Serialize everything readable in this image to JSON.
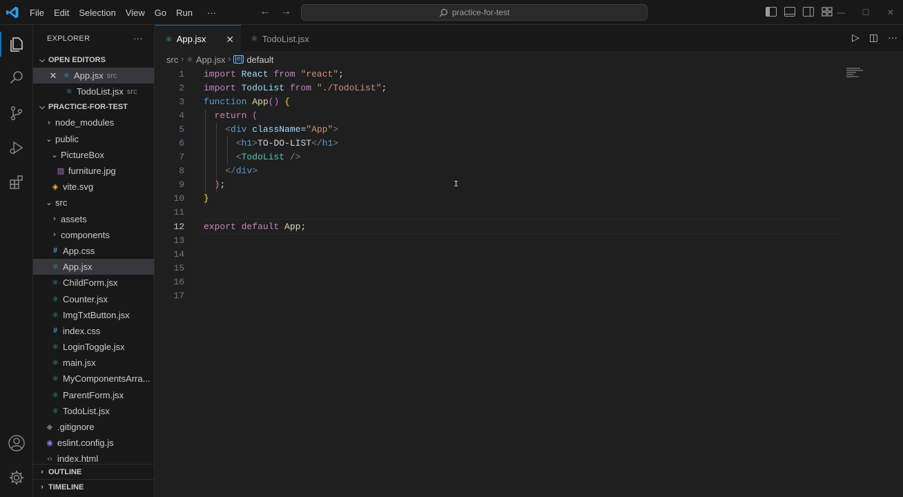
{
  "titlebar": {
    "menu": [
      "File",
      "Edit",
      "Selection",
      "View",
      "Go",
      "Run",
      "···"
    ],
    "command_center": "practice-for-test",
    "back_icon": "arrow-left-icon",
    "forward_icon": "arrow-right-icon"
  },
  "sidebar": {
    "title": "EXPLORER",
    "more": "···",
    "open_editors_label": "OPEN EDITORS",
    "open_editors": [
      {
        "name": "App.jsx",
        "hint": "src"
      },
      {
        "name": "TodoList.jsx",
        "hint": "src"
      }
    ],
    "project_label": "PRACTICE-FOR-TEST",
    "tree": {
      "node_modules": "node_modules",
      "public": "public",
      "picturebox": "PictureBox",
      "furniture": "furniture.jpg",
      "vite": "vite.svg",
      "src": "src",
      "assets": "assets",
      "components": "components",
      "app_css": "App.css",
      "app_jsx": "App.jsx",
      "childform": "ChildForm.jsx",
      "counter": "Counter.jsx",
      "imgtxt": "ImgTxtButton.jsx",
      "index_css": "index.css",
      "logintoggle": "LoginToggle.jsx",
      "main": "main.jsx",
      "mycomponents": "MyComponentsArra...",
      "parentform": "ParentForm.jsx",
      "todolist": "TodoList.jsx",
      "gitignore": ".gitignore",
      "eslint": "eslint.config.js",
      "index_html": "index.html"
    },
    "outline_label": "OUTLINE",
    "timeline_label": "TIMELINE"
  },
  "tabs": [
    {
      "label": "App.jsx",
      "active": true
    },
    {
      "label": "TodoList.jsx",
      "active": false
    }
  ],
  "breadcrumb": {
    "folder": "src",
    "file": "App.jsx",
    "symbol": "default"
  },
  "editor": {
    "line_numbers": [
      "1",
      "2",
      "3",
      "4",
      "5",
      "6",
      "7",
      "8",
      "9",
      "10",
      "11",
      "12",
      "13",
      "14",
      "15",
      "16",
      "17"
    ],
    "current_line": "12",
    "code": {
      "l1_import": "import",
      "l1_name": "React",
      "l1_from": "from",
      "l1_str": "\"react\"",
      "l1_end": ";",
      "l2_import": "import",
      "l2_name": "TodoList",
      "l2_from": "from",
      "l2_str": "\"./TodoList\"",
      "l2_end": ";",
      "l3_kw": "function",
      "l3_fn": "App",
      "l3_paren": "()",
      "l3_brace": "{",
      "l4_kw": "return",
      "l4_paren": "(",
      "l5_open": "<",
      "l5_tag": "div",
      "l5_attr": "className",
      "l5_eq": "=",
      "l5_val": "\"App\"",
      "l5_close": ">",
      "l6_open": "<",
      "l6_tag": "h1",
      "l6_close": ">",
      "l6_text": "TO-DO-LIST",
      "l6_end_open": "</",
      "l6_end_tag": "h1",
      "l6_end_close": ">",
      "l7_open": "<",
      "l7_tag": "TodoList",
      "l7_close": " />",
      "l8_open": "</",
      "l8_tag": "div",
      "l8_close": ">",
      "l9_paren": ")",
      "l9_semi": ";",
      "l10_brace": "}",
      "l12_export": "export",
      "l12_default": "default",
      "l12_name": "App",
      "l12_semi": ";"
    }
  },
  "colors": {
    "accent": "#0078d4",
    "background": "#1f1f1f",
    "sidebar": "#181818",
    "selection": "#37373d"
  }
}
